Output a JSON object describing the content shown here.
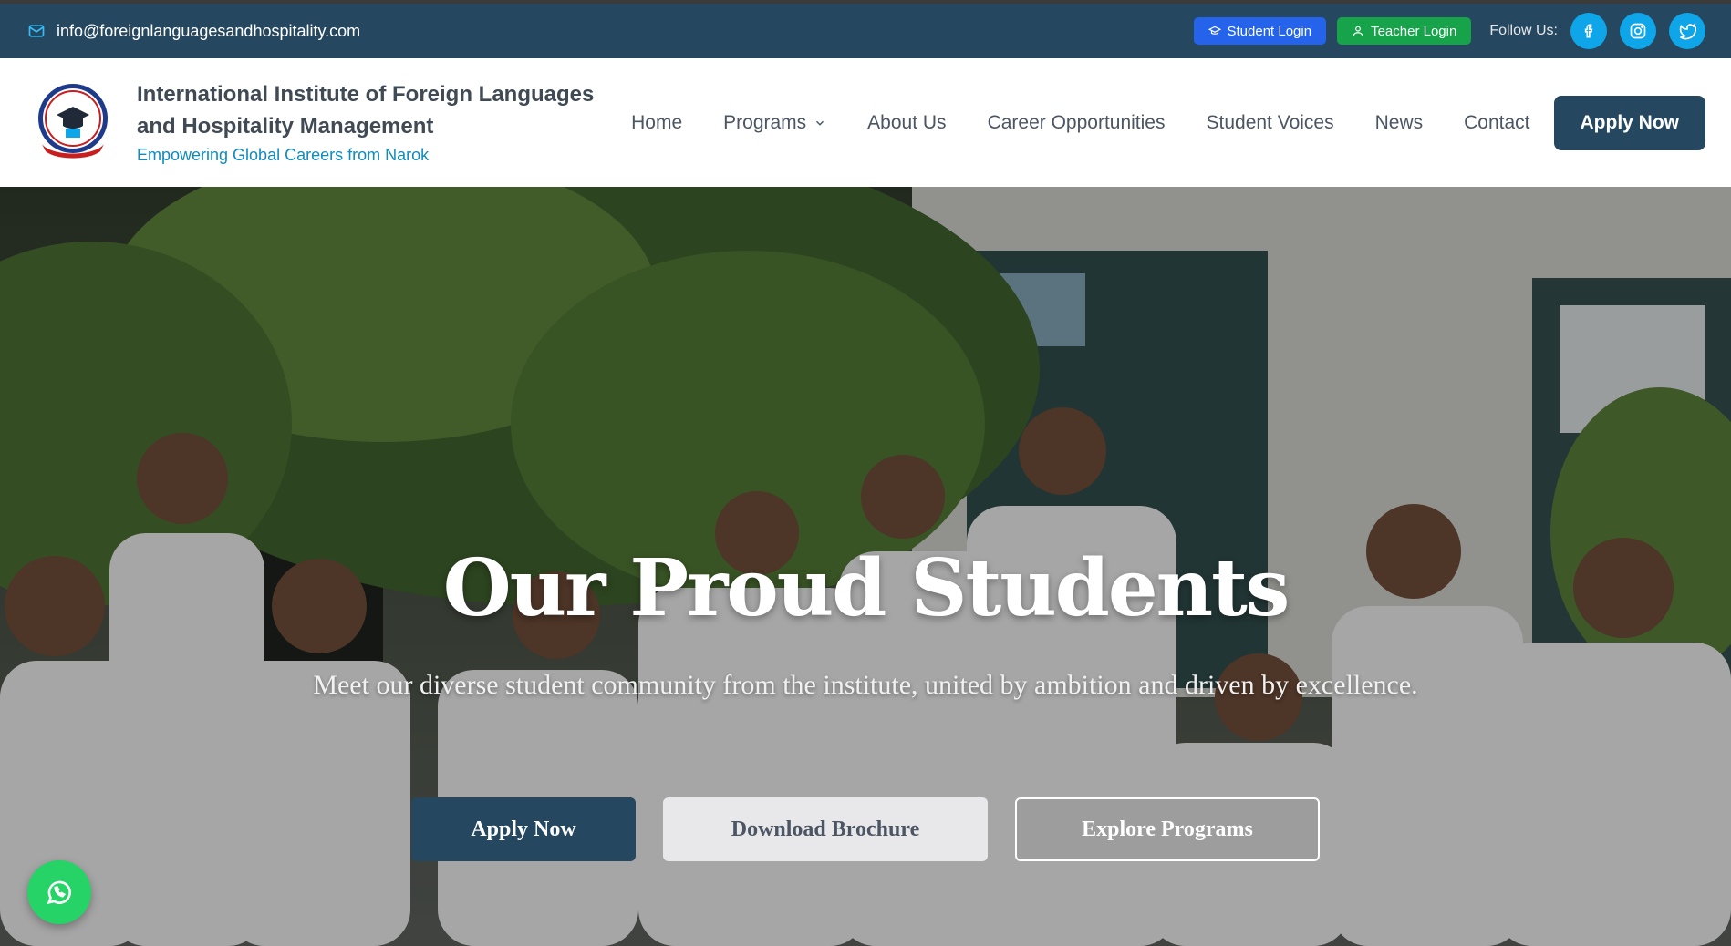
{
  "topbar": {
    "email": "info@foreignlanguagesandhospitality.com",
    "student_login": "Student Login",
    "teacher_login": "Teacher Login",
    "follow_label": "Follow Us:",
    "socials": [
      "facebook-icon",
      "instagram-icon",
      "twitter-icon"
    ]
  },
  "header": {
    "brand_line1": "International Institute of Foreign Languages",
    "brand_line2": "and Hospitality Management",
    "tagline": "Empowering Global Careers from Narok",
    "nav": {
      "home": "Home",
      "programs": "Programs",
      "about": "About Us",
      "careers": "Career Opportunities",
      "voices": "Student Voices",
      "news": "News",
      "contact": "Contact"
    },
    "apply_label": "Apply Now"
  },
  "hero": {
    "title": "Our Proud Students",
    "subtitle": "Meet our diverse student community from the institute, united by ambition and driven by excellence.",
    "apply_label": "Apply Now",
    "brochure_label": "Download Brochure",
    "explore_label": "Explore Programs"
  },
  "colors": {
    "topbar_bg": "#25475f",
    "primary": "#25475f",
    "student_login": "#2563eb",
    "teacher_login": "#16a34a",
    "social": "#0ea5e9",
    "tagline": "#0f8bbd",
    "whatsapp": "#25d366"
  }
}
